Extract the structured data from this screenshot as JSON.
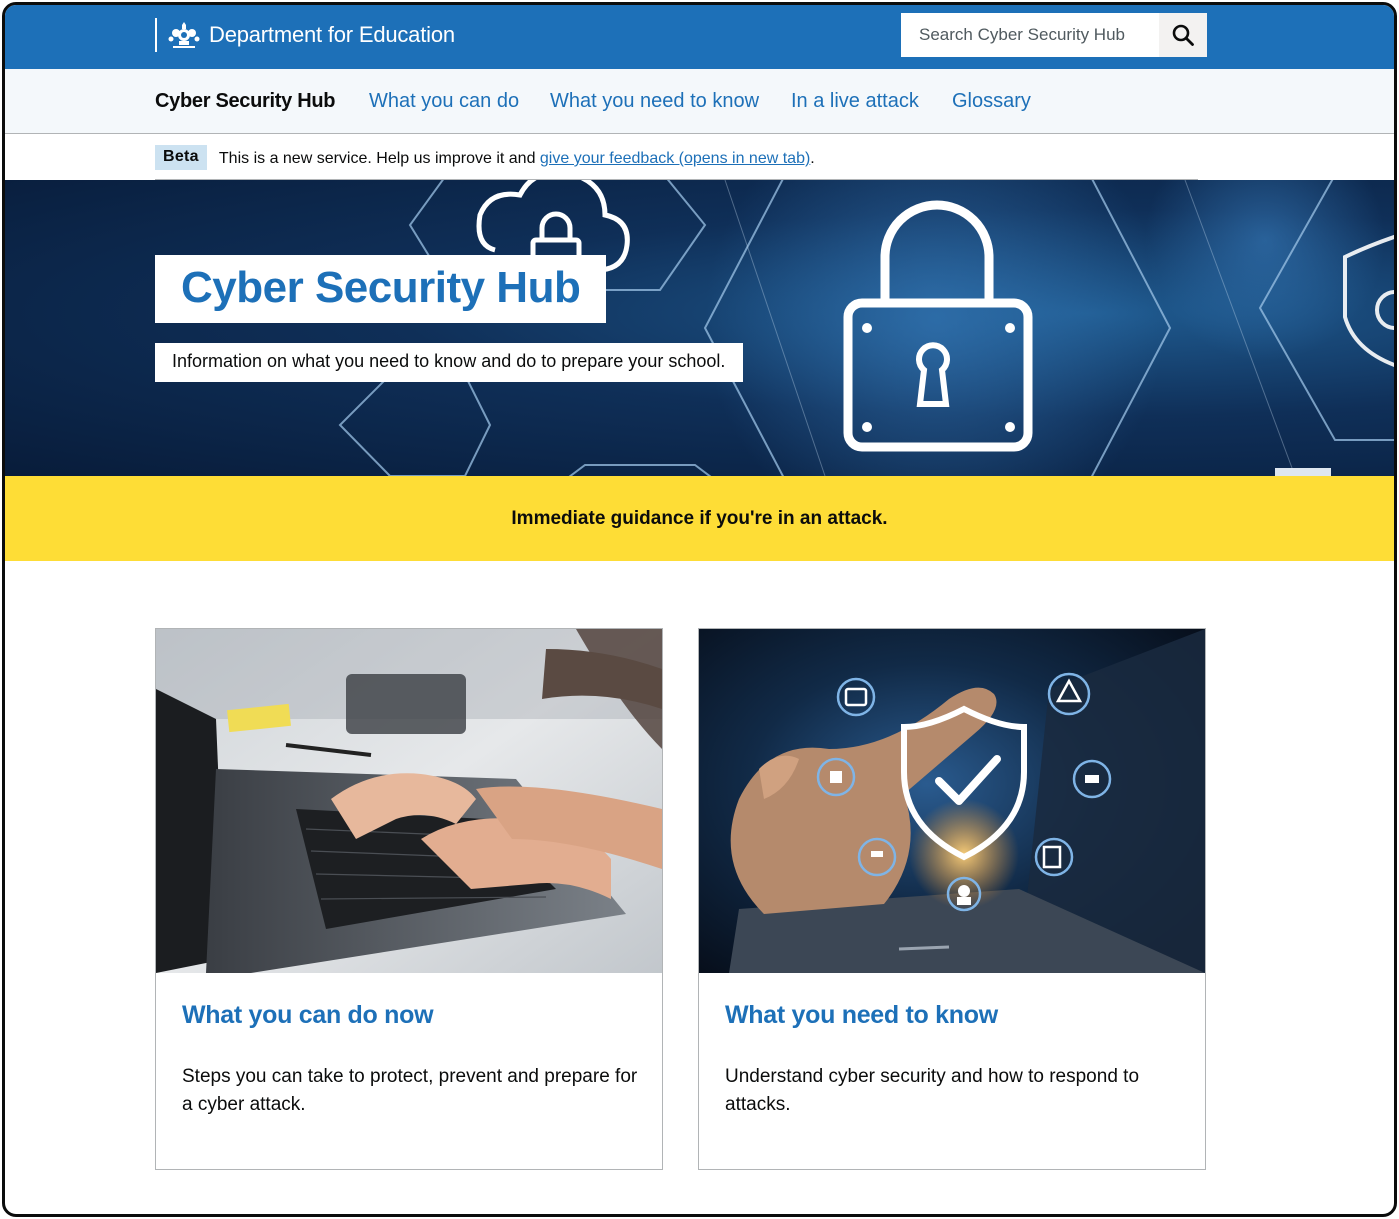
{
  "header": {
    "org_name": "Department for Education",
    "search_placeholder": "Search Cyber Security Hub",
    "brand_color": "#1d70b8"
  },
  "service_nav": {
    "service_name": "Cyber Security Hub",
    "links": [
      "What you can do",
      "What you need to know",
      "In a live attack",
      "Glossary"
    ]
  },
  "beta": {
    "tag": "Beta",
    "text_before": "This is a new service. Help us improve it and ",
    "link_text": "give your feedback (opens in new tab)",
    "text_after": "."
  },
  "hero": {
    "title": "Cyber Security Hub",
    "subtitle": "Information on what you need to know and do to prepare your school."
  },
  "alert": {
    "text": "Immediate guidance if you're in an attack.",
    "color": "#fedd36"
  },
  "cards": [
    {
      "title": "What you can do now",
      "description": "Steps you can take to protect, prevent and prepare for a cyber attack.",
      "image": "hands-typing-on-laptop"
    },
    {
      "title": "What you need to know",
      "description": "Understand cyber security and how to respond to attacks.",
      "image": "finger-touching-shield-checkmark-icons"
    }
  ]
}
